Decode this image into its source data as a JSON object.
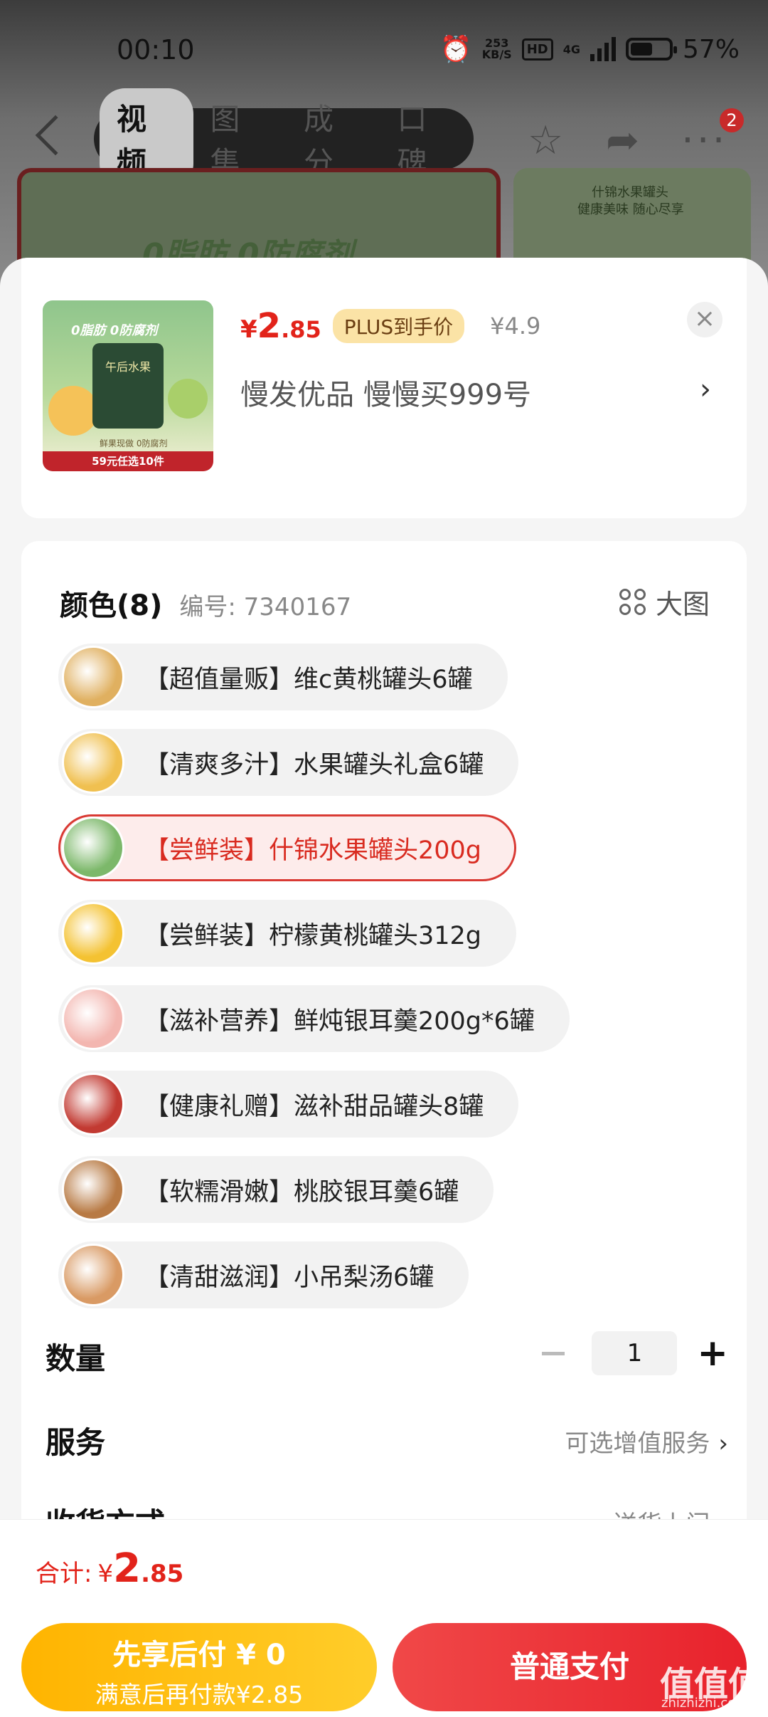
{
  "status_bar": {
    "time": "00:10",
    "net_speed_value": "253",
    "net_speed_unit": "KB/S",
    "hd": "HD",
    "network": "4G",
    "battery": "57%",
    "battery_level": 0.57
  },
  "nav": {
    "tabs": [
      "视频",
      "图集",
      "成分",
      "口碑"
    ],
    "active_tab": 0,
    "badge_count": "2"
  },
  "background": {
    "hero_text": "0脂肪 0防腐剂",
    "thumb_text": "什锦水果罐头",
    "thumb_sub": "健康美味 随心尽享"
  },
  "product": {
    "thumb_title": "0脂肪 0防腐剂",
    "thumb_can": "午后水果",
    "thumb_sub": "鲜果现做 0防腐剂",
    "thumb_banner": "59元任选10件",
    "price_symbol": "¥",
    "price_int": "2",
    "price_dec": ".85",
    "plus_tag": "PLUS到手价",
    "orig_price": "¥4.9",
    "seller": "慢发优品  慢慢买999号",
    "close": "×",
    "arrow": "›"
  },
  "color_section": {
    "title": "颜色(8)",
    "code": "编号: 7340167",
    "big_image": "大图",
    "options": [
      {
        "label": "【超值量贩】维c黄桃罐头6罐",
        "color": "#e0b060"
      },
      {
        "label": "【清爽多汁】水果罐头礼盒6罐",
        "color": "#f0c050"
      },
      {
        "label": "【尝鲜装】什锦水果罐头200g",
        "color": "#7cb86a",
        "selected": true
      },
      {
        "label": "【尝鲜装】柠檬黄桃罐头312g",
        "color": "#f4c232"
      },
      {
        "label": "【滋补营养】鲜炖银耳羹200g*6罐",
        "color": "#f3b6b0"
      },
      {
        "label": "【健康礼赠】滋补甜品罐头8罐",
        "color": "#c23a32"
      },
      {
        "label": "【软糯滑嫩】桃胶银耳羹6罐",
        "color": "#b87a44"
      },
      {
        "label": "【清甜滋润】小吊梨汤6罐",
        "color": "#d99a64"
      }
    ]
  },
  "quantity": {
    "title": "数量",
    "value": "1",
    "minus": "−",
    "plus": "+"
  },
  "service": {
    "title": "服务",
    "hint": "可选增值服务",
    "arrow": "›"
  },
  "delivery": {
    "title": "收货方式",
    "hint": "送货上门",
    "arrow": "›"
  },
  "total": {
    "label": "合计:",
    "symbol": "¥",
    "int": "2",
    "dec": ".85"
  },
  "buttons": {
    "later_line1": "先享后付 ¥ 0",
    "later_line2": "满意后再付款¥2.85",
    "pay": "普通支付"
  },
  "watermark": {
    "text": "值值值",
    "sub": "zhizhizhi.com"
  },
  "colors": {
    "accent_red": "#e2231a",
    "plus_gold": "#fbe3a6",
    "later_yellow": "#ffb400",
    "pay_red": "#e8222c"
  }
}
